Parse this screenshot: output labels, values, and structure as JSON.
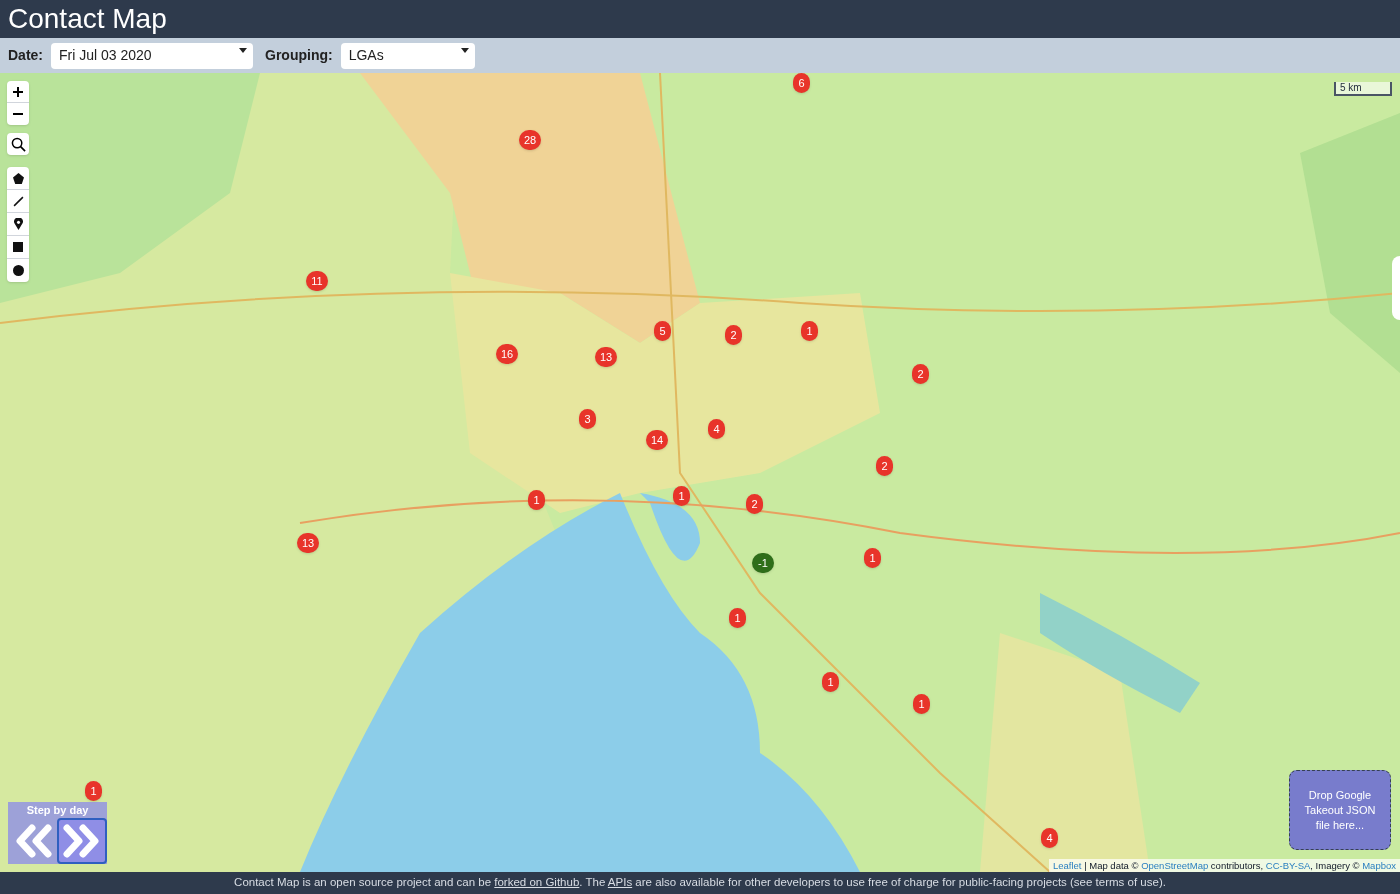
{
  "title": "Contact Map",
  "filters": [
    {
      "label": "Date:",
      "value": "Fri Jul 03 2020"
    },
    {
      "label": "Grouping:",
      "value": "LGAs"
    }
  ],
  "map": {
    "scale": "5 km",
    "step_control": {
      "title": "Step by day"
    },
    "drop_zone": "Drop Google Takeout JSON file here...",
    "markers": [
      {
        "label": "6",
        "color": "#e8342a"
      },
      {
        "label": "28",
        "color": "#e8342a"
      },
      {
        "label": "11",
        "color": "#e8342a"
      },
      {
        "label": "5",
        "color": "#e8342a"
      },
      {
        "label": "2",
        "color": "#e8342a"
      },
      {
        "label": "1",
        "color": "#e8342a"
      },
      {
        "label": "16",
        "color": "#e8342a"
      },
      {
        "label": "13",
        "color": "#e8342a"
      },
      {
        "label": "2",
        "color": "#e8342a"
      },
      {
        "label": "3",
        "color": "#e8342a"
      },
      {
        "label": "4",
        "color": "#e8342a"
      },
      {
        "label": "14",
        "color": "#e8342a"
      },
      {
        "label": "2",
        "color": "#e8342a"
      },
      {
        "label": "1",
        "color": "#e8342a"
      },
      {
        "label": "1",
        "color": "#e8342a"
      },
      {
        "label": "2",
        "color": "#e8342a"
      },
      {
        "label": "13",
        "color": "#e8342a"
      },
      {
        "label": "1",
        "color": "#e8342a"
      },
      {
        "label": "-1",
        "color": "#2f6e1a"
      },
      {
        "label": "1",
        "color": "#e8342a"
      },
      {
        "label": "1",
        "color": "#e8342a"
      },
      {
        "label": "1",
        "color": "#e8342a"
      },
      {
        "label": "1",
        "color": "#e8342a"
      },
      {
        "label": "4",
        "color": "#e8342a"
      }
    ],
    "attribution": [
      {
        "kind": "link",
        "text": "Leaflet"
      },
      {
        "kind": "text",
        "text": " | Map data © "
      },
      {
        "kind": "link",
        "text": "OpenStreetMap"
      },
      {
        "kind": "text",
        "text": " contributors, "
      },
      {
        "kind": "link",
        "text": "CC-BY-SA"
      },
      {
        "kind": "text",
        "text": ", Imagery © "
      },
      {
        "kind": "link",
        "text": "Mapbox"
      }
    ]
  },
  "footer": [
    {
      "kind": "text",
      "text": "Contact Map is an open source project and can be "
    },
    {
      "kind": "link",
      "text": "forked on Github"
    },
    {
      "kind": "text",
      "text": ". The "
    },
    {
      "kind": "link",
      "text": "APIs"
    },
    {
      "kind": "text",
      "text": " are also available for other developers to use free of charge for public-facing projects (see terms of use)."
    }
  ]
}
